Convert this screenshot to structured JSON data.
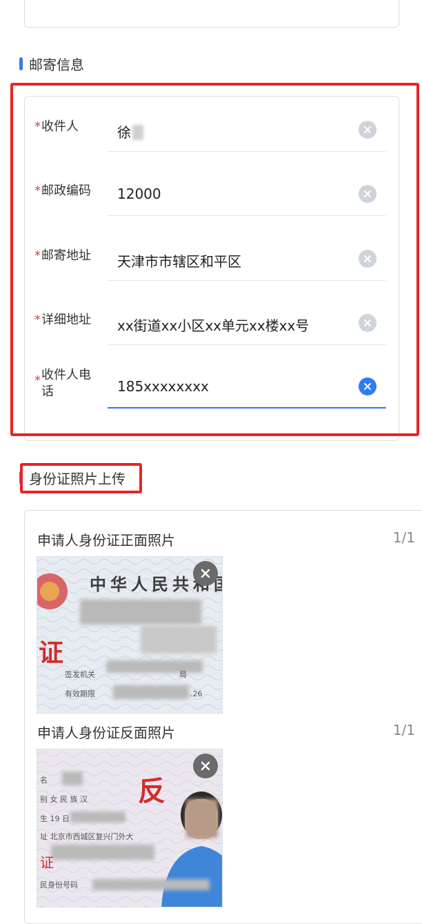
{
  "mail_section": {
    "title": "邮寄信息",
    "fields": [
      {
        "label": "收件人",
        "value": "徐",
        "required": true
      },
      {
        "label": "邮政编码",
        "value": "12000",
        "required": true
      },
      {
        "label": "邮寄地址",
        "value": "天津市市辖区和平区",
        "required": true
      },
      {
        "label": "详细地址",
        "value": "xx街道xx小区xx单元xx楼xx号",
        "required": true
      },
      {
        "label": "收件人电话",
        "label_line1": "收件人电",
        "label_line2": "话",
        "value": "185xxxxxxxx",
        "required": true
      }
    ],
    "required_mark": "*"
  },
  "id_section": {
    "title": "身份证照片上传",
    "front": {
      "title": "申请人身份证正面照片",
      "count": "1/1",
      "header_text": "中华人民共和国",
      "big_char": "证",
      "small_text1": "签发机关",
      "small_text2": "有效期限",
      "suffix1": "局",
      "suffix2": ".26"
    },
    "back": {
      "title": "申请人身份证反面照片",
      "count": "1/1",
      "big_char": "反",
      "line_name": "名",
      "line_sex": "别  女    民 族 汉",
      "line_birth": "生  19                    日",
      "line_addr": "址   北京市西城区复兴门外大",
      "line_id": "民身份号码",
      "side_char": "证"
    }
  },
  "colors": {
    "accent": "#2f7bf6",
    "highlight": "#ee2222",
    "required": "#e23b3b"
  }
}
